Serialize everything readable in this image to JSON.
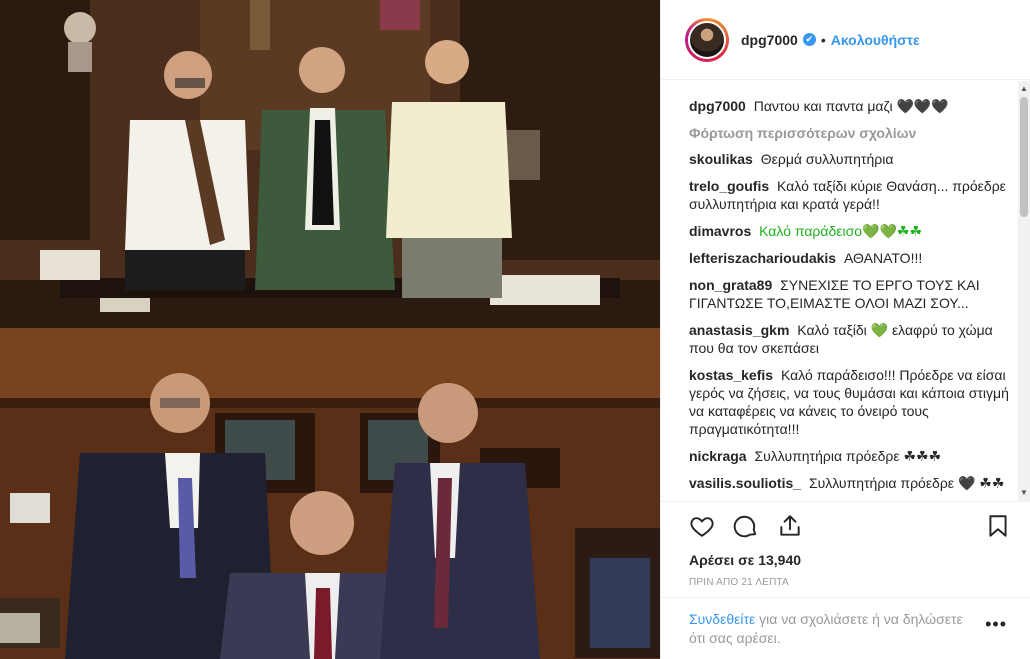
{
  "post": {
    "username": "dpg7000",
    "follow_label": "Ακολουθήστε",
    "separator": "•",
    "verified_mark": "✔",
    "caption": "Παντου και παντα μαζι 🖤🖤🖤"
  },
  "load_more_label": "Φόρτωση περισσότερων σχολίων",
  "comments": [
    {
      "user": "skoulikas",
      "text": "Θερμά συλλυπητήρια"
    },
    {
      "user": "trelo_goufis",
      "text": "Καλό ταξίδι κύριε Θανάση... πρόεδρε συλλυπητήρια και κρατά γερά!!"
    },
    {
      "user": "dimavros",
      "text": "Καλό παράδεισο💚💚☘☘"
    },
    {
      "user": "lefteriszacharioudakis",
      "text": "ΑΘΑΝΑΤΟ!!!"
    },
    {
      "user": "non_grata89",
      "text": "ΣΥΝΕΧΙΣΕ ΤΟ ΕΡΓΟ ΤΟΥΣ ΚΑΙ ΓΙΓΑΝΤΩΣΕ ΤΟ,ΕΙΜΑΣΤΕ ΟΛΟΙ ΜΑΖΙ ΣΟΥ..."
    },
    {
      "user": "anastasis_gkm",
      "text": "Καλό ταξίδι 💚 ελαφρύ το χώμα που θα τον σκεπάσει"
    },
    {
      "user": "kostas_kefis",
      "text": "Καλό παράδεισο!!! Πρόεδρε να είσαι γερός να ζήσεις, να τους θυμάσαι και κάποια στιγμή να καταφέρεις να κάνεις το όνειρό τους πραγματικότητα!!!"
    },
    {
      "user": "nickraga",
      "text": "Συλλυπητήρια πρόεδρε ☘☘☘"
    },
    {
      "user": "vasilis.souliotis_",
      "text": "Συλλυπητήρια πρόεδρε 🖤 ☘☘"
    }
  ],
  "likes_text": "Αρέσει σε 13,940",
  "time_text": "ΠΡΙΝ ΑΠΟ 21 ΛΕΠΤΑ",
  "login": {
    "link": "Συνδεθείτε",
    "rest": " για να σχολιάσετε ή να δηλώσετε ότι σας αρέσει."
  },
  "more_label": "•••",
  "icons": {
    "like": "heart-icon",
    "comment": "comment-bubble-icon",
    "share": "share-icon",
    "save": "bookmark-icon",
    "more": "more-options-icon"
  },
  "colors": {
    "link_blue": "#3897f0",
    "text": "#262626",
    "muted": "#999999",
    "green_heart": "#1db21d"
  }
}
